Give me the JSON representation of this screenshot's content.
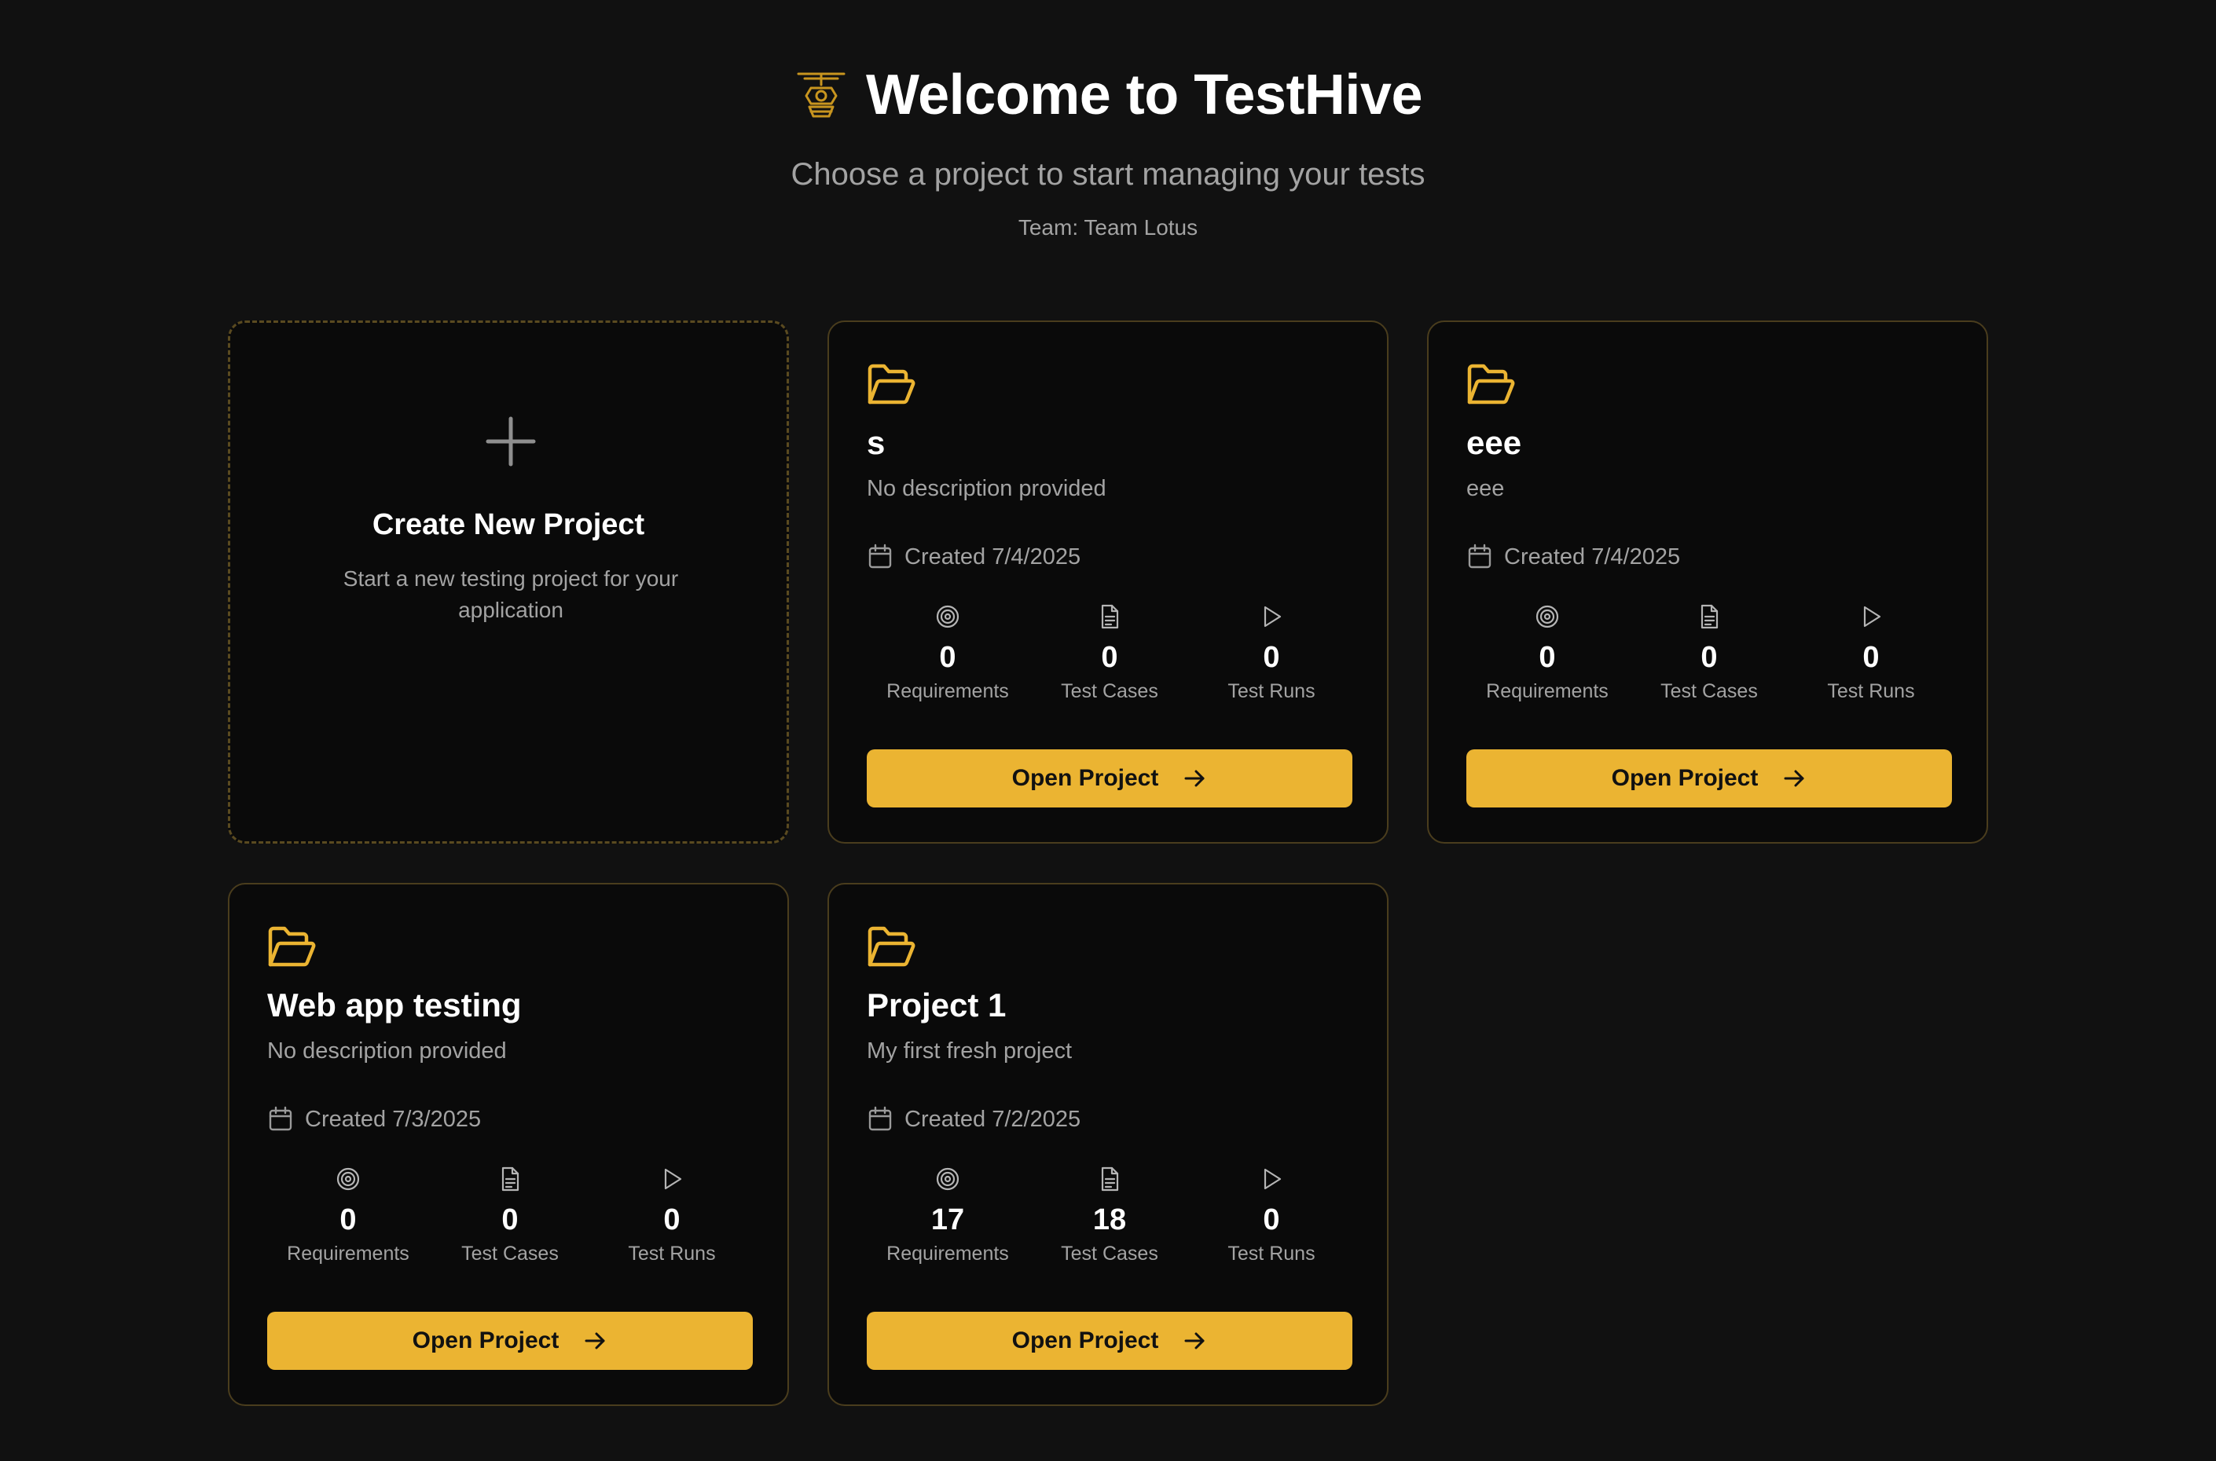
{
  "header": {
    "title": "Welcome to TestHive",
    "subtitle": "Choose a project to start managing your tests",
    "team": "Team: Team Lotus",
    "logo_icon": "hive-drone-icon"
  },
  "colors": {
    "background": "#111111",
    "card_background": "#0a0a0a",
    "card_border": "#4a3d1d",
    "accent": "#ebb432",
    "muted_text": "#a3a3a3",
    "text": "#ffffff"
  },
  "create_card": {
    "title": "Create New Project",
    "description": "Start a new testing project for your application",
    "icon": "plus-icon"
  },
  "stat_labels": {
    "requirements": "Requirements",
    "test_cases": "Test Cases",
    "test_runs": "Test Runs"
  },
  "projects": [
    {
      "name": "s",
      "description": "No description provided",
      "created": "Created 7/4/2025",
      "requirements": "0",
      "test_cases": "0",
      "test_runs": "0",
      "button_label": "Open Project"
    },
    {
      "name": "eee",
      "description": "eee",
      "created": "Created 7/4/2025",
      "requirements": "0",
      "test_cases": "0",
      "test_runs": "0",
      "button_label": "Open Project"
    },
    {
      "name": "Web app testing",
      "description": "No description provided",
      "created": "Created 7/3/2025",
      "requirements": "0",
      "test_cases": "0",
      "test_runs": "0",
      "button_label": "Open Project"
    },
    {
      "name": "Project 1",
      "description": "My first fresh project",
      "created": "Created 7/2/2025",
      "requirements": "17",
      "test_cases": "18",
      "test_runs": "0",
      "button_label": "Open Project"
    }
  ]
}
